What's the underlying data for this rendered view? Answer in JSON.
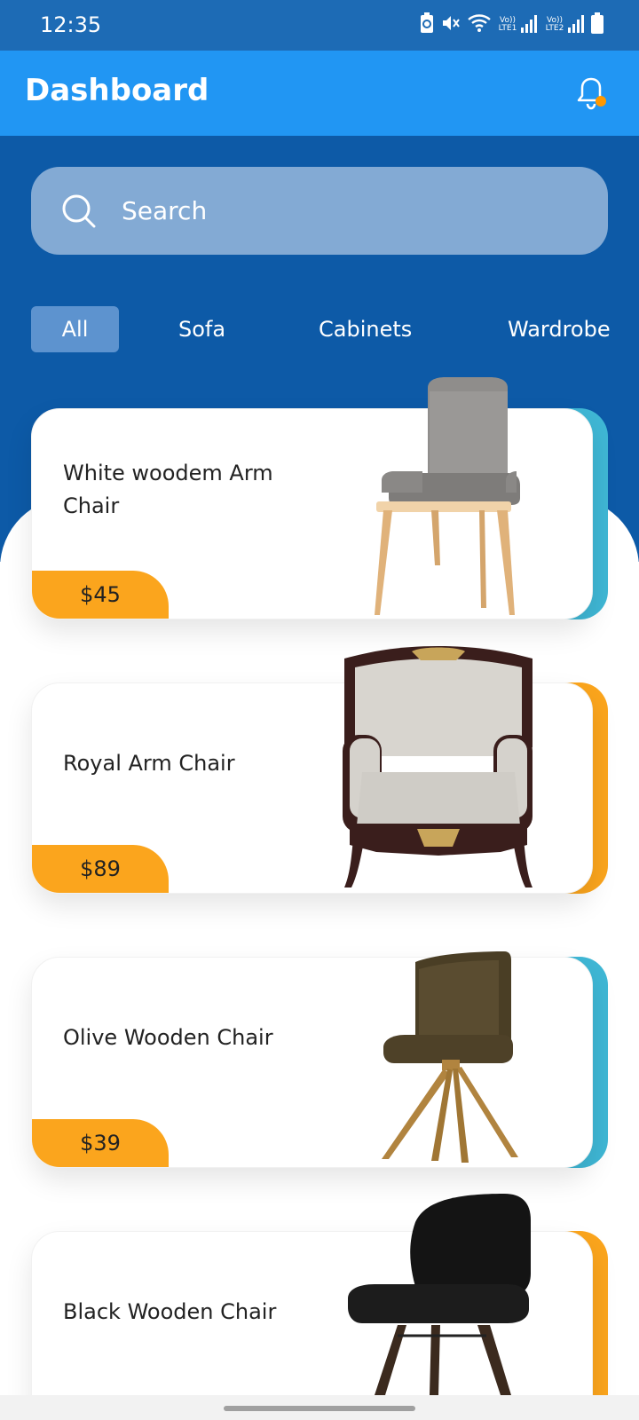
{
  "status_bar": {
    "time": "12:35",
    "sim1_label": "Vo)) LTE1",
    "sim2_label": "Vo)) LTE2",
    "icons": [
      "battery-saver-icon",
      "mute-icon",
      "wifi-icon",
      "signal-icon",
      "signal-icon",
      "battery-icon"
    ]
  },
  "app_bar": {
    "title": "Dashboard",
    "notification_icon": "bell-icon"
  },
  "search": {
    "placeholder": "Search"
  },
  "tabs": [
    {
      "label": "All",
      "active": true
    },
    {
      "label": "Sofa",
      "active": false
    },
    {
      "label": "Cabinets",
      "active": false
    },
    {
      "label": "Wardrobe",
      "active": false
    }
  ],
  "products": [
    {
      "name": "White woodem Arm Chair",
      "price": "$45",
      "accent": "#3fb7d5"
    },
    {
      "name": "Royal Arm Chair",
      "price": "$89",
      "accent": "#fba51d"
    },
    {
      "name": "Olive Wooden Chair",
      "price": "$39",
      "accent": "#3fb7d5"
    },
    {
      "name": "Black Wooden Chair",
      "price": "",
      "accent": "#fba51d"
    }
  ],
  "colors": {
    "status_bar": "#1d6bb5",
    "app_bar": "#2196f3",
    "hero": "#0d5aa7",
    "price_tag": "#fba51d",
    "bell_dot": "#ff9800"
  }
}
